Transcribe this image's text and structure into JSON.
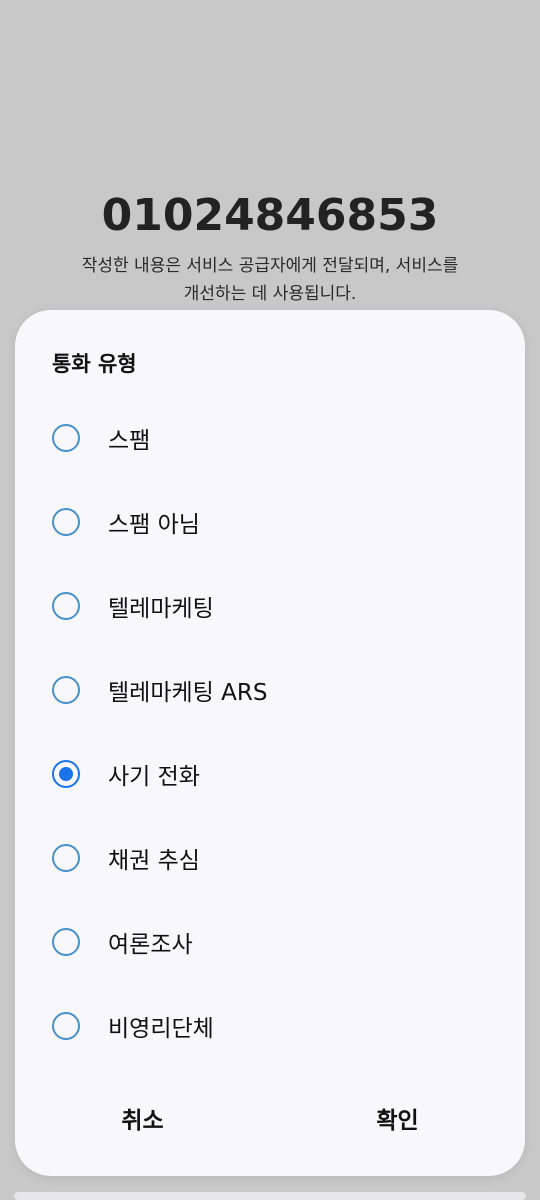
{
  "background": {
    "phone_number": "01024846853",
    "notice_line1": "작성한 내용은 서비스 공급자에게 전달되며, 서비스를",
    "notice_line2": "개선하는 데 사용됩니다."
  },
  "dialog": {
    "title": "통화 유형",
    "options": [
      {
        "label": "스팸",
        "checked": false
      },
      {
        "label": "스팸 아님",
        "checked": false
      },
      {
        "label": "텔레마케팅",
        "checked": false
      },
      {
        "label": "텔레마케팅 ARS",
        "checked": false
      },
      {
        "label": "사기 전화",
        "checked": true
      },
      {
        "label": "채권 추심",
        "checked": false
      },
      {
        "label": "여론조사",
        "checked": false
      },
      {
        "label": "비영리단체",
        "checked": false
      }
    ],
    "cancel_label": "취소",
    "confirm_label": "확인"
  },
  "colors": {
    "accent": "#1a73e8",
    "radio_border": "#4a90c8",
    "scrim": "#c8c8c8",
    "dialog_bg": "#f8f8fc"
  }
}
